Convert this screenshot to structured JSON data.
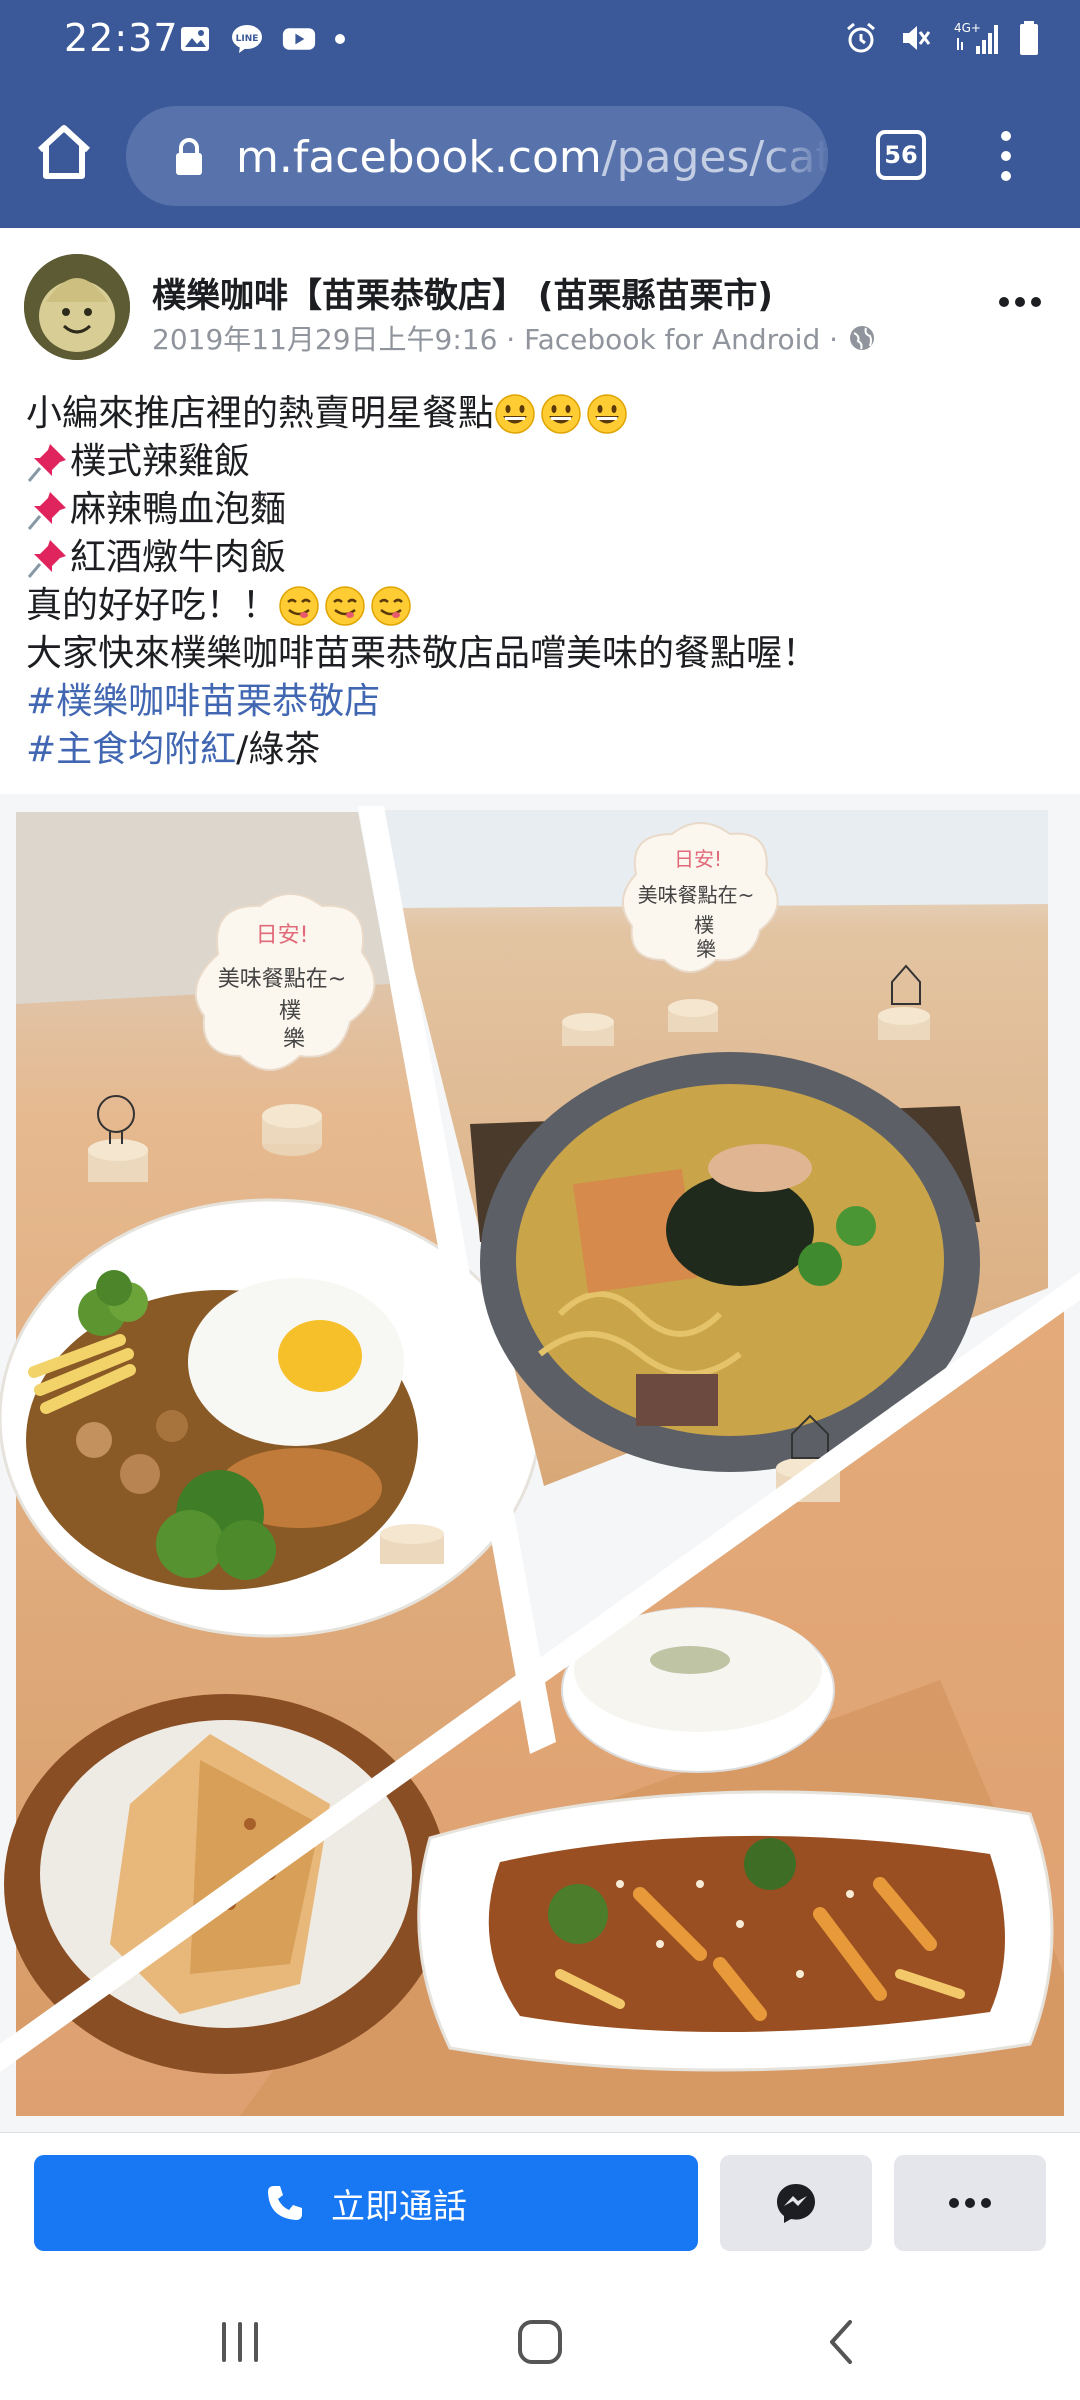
{
  "status_bar": {
    "time": "22:37",
    "network": "4G+",
    "icons_left": [
      "gallery-icon",
      "line-icon",
      "youtube-icon",
      "dot-icon"
    ],
    "icons_right": [
      "alarm-icon",
      "mute-icon",
      "signal-icon",
      "battery-icon"
    ]
  },
  "browser": {
    "url_host": "m.facebook.com",
    "url_path": "/pages/cat",
    "tab_count": "56"
  },
  "post": {
    "page_name": "樸樂咖啡【苗栗恭敬店】 (苗栗縣苗栗市)",
    "meta": "2019年11月29日上午9:16 · Facebook for Android ·",
    "lines": {
      "intro": "小編來推店裡的熱賣明星餐點",
      "item1": "樸式辣雞飯",
      "item2": "麻辣鴨血泡麵",
      "item3": "紅酒燉牛肉飯",
      "praise": "真的好好吃！！",
      "invite": "大家快來樸樂咖啡苗栗恭敬店品嚐美味的餐點喔！",
      "hashtag1": "#樸樂咖啡苗栗恭敬店",
      "hashtag2": "#主食均附紅",
      "hashtag2_suffix": "/綠茶"
    }
  },
  "photo_signs": {
    "hello": "日安!",
    "tagline": "美味餐點在~",
    "brand1": "樸",
    "brand2": "樂"
  },
  "actions": {
    "call_label": "立即通話"
  },
  "colors": {
    "chrome": "#3b5998",
    "accent": "#1877f2",
    "hashtag": "#4267b2"
  }
}
